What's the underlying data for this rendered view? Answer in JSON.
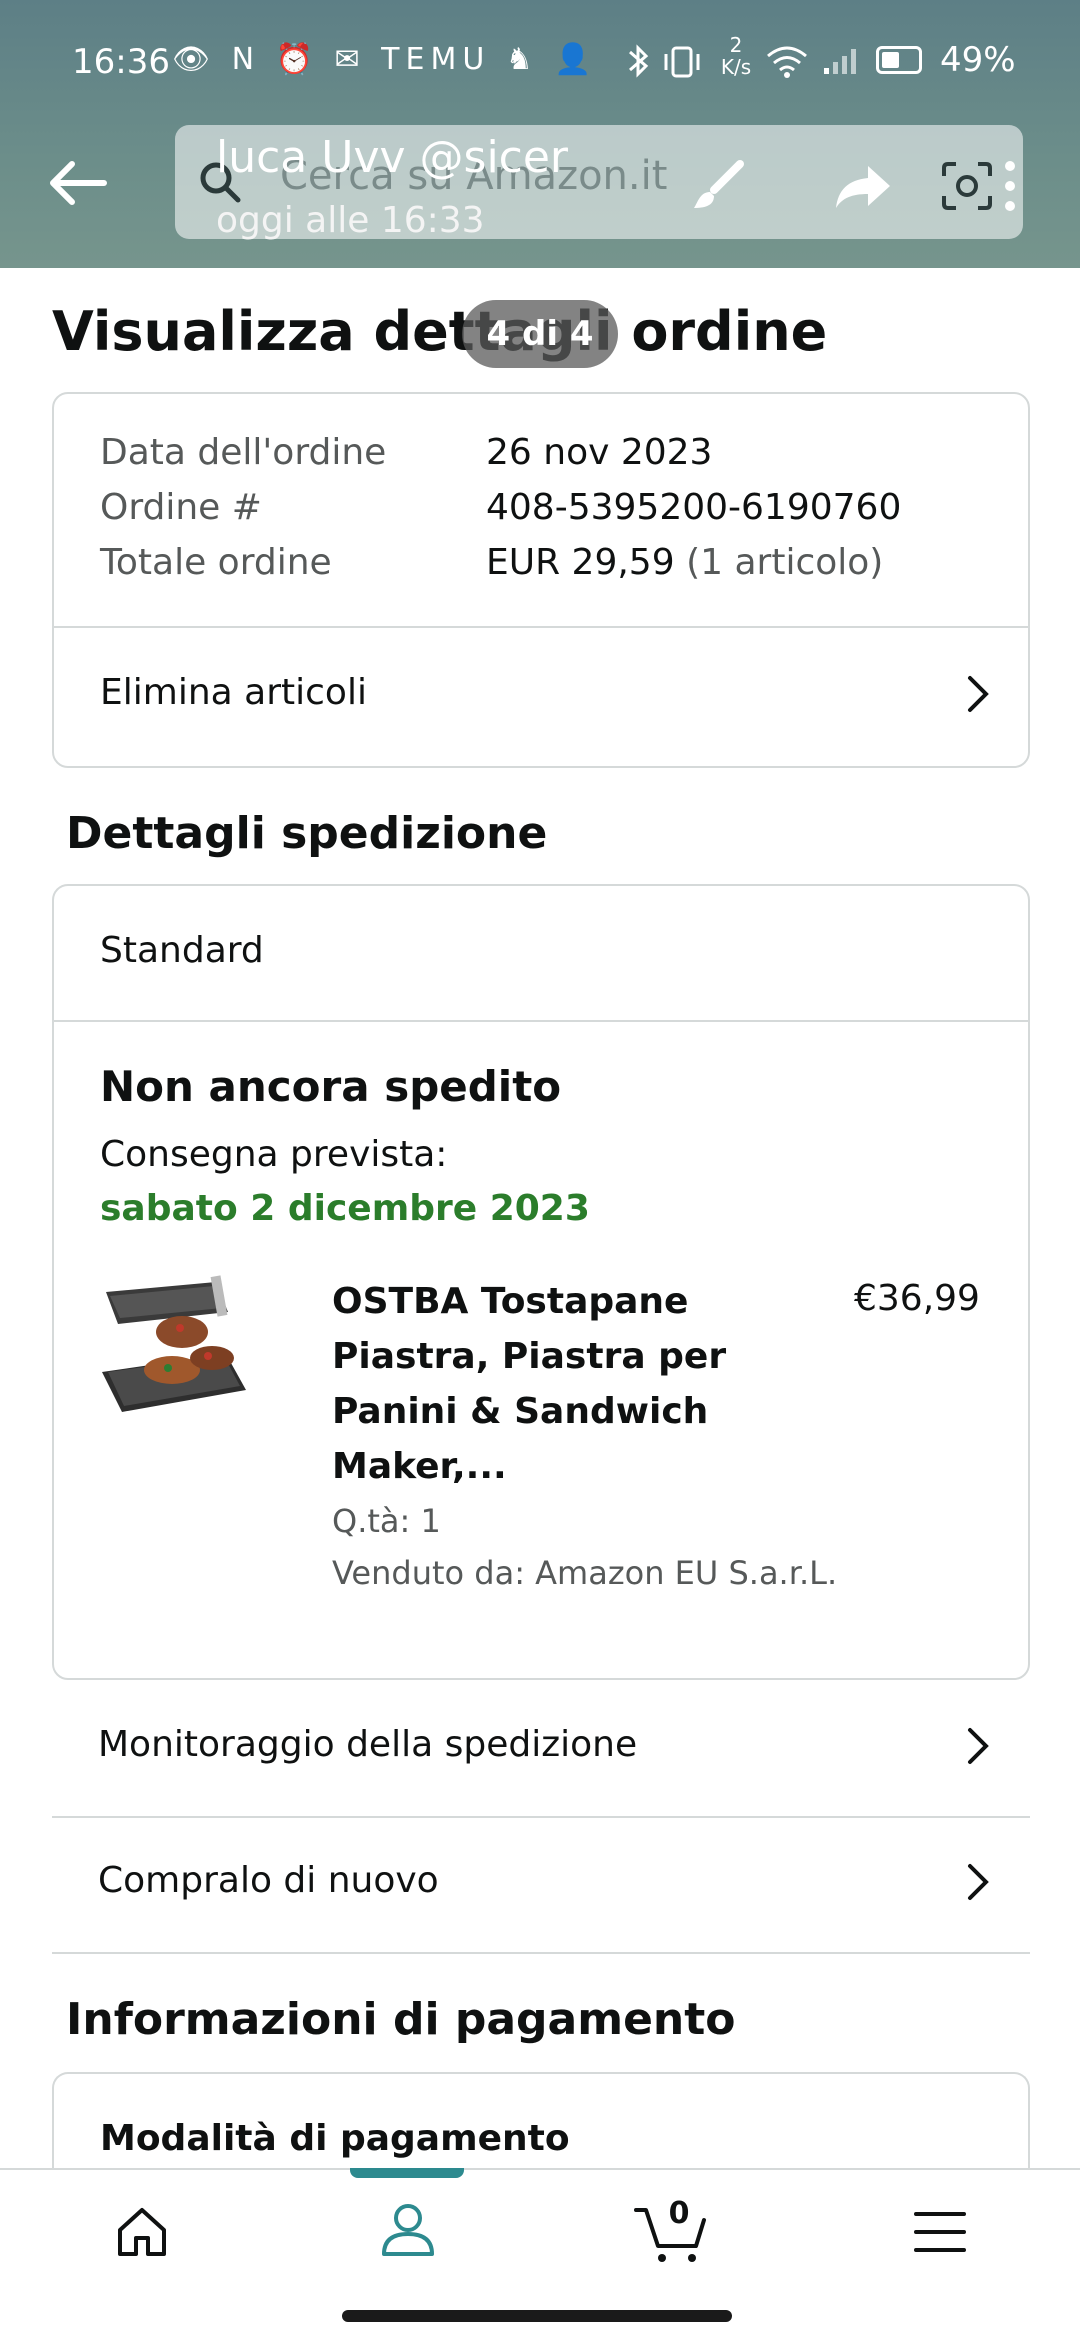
{
  "status": {
    "time": "16:36",
    "icons_left": "👁 N ⏰ ✉ TEMU ♞ 👤",
    "net_speed": "2 K/s",
    "battery_pct": "49%",
    "battery_level": 0.49
  },
  "viewer": {
    "sender": "luca Uvv @sicer",
    "timestamp": "oggi alle 16:33",
    "counter": "4 di 4"
  },
  "search": {
    "placeholder": "Cerca su Amazon.it"
  },
  "page": {
    "title": "Visualizza dettagli ordine"
  },
  "order": {
    "rows": [
      {
        "label": "Data dell'ordine",
        "value": "26 nov 2023"
      },
      {
        "label": "Ordine #",
        "value": "408-5395200-6190760"
      },
      {
        "label": "Totale ordine",
        "value": "EUR 29,59",
        "value_extra": "(1 articolo)"
      }
    ],
    "delete_items": "Elimina articoli"
  },
  "shipping": {
    "section_title": "Dettagli spedizione",
    "method": "Standard",
    "status": "Non ancora spedito",
    "expected_label": "Consegna prevista:",
    "expected_date": "sabato 2 dicembre 2023",
    "item": {
      "title_lines": [
        "OSTBA Tostapane",
        "Piastra, Piastra per",
        "Panini & Sandwich",
        "Maker,..."
      ],
      "price": "€36,99",
      "qty": "Q.tà: 1",
      "seller": "Venduto da: Amazon EU S.a.r.L."
    },
    "links": [
      "Monitoraggio della spedizione",
      "Compralo di nuovo"
    ]
  },
  "payment": {
    "section_title": "Informazioni di pagamento",
    "method_label": "Modalità di pagamento"
  },
  "nav": {
    "cart_count": "0"
  },
  "colors": {
    "green": "#2b7d2b",
    "accent": "#2d8a8f"
  }
}
